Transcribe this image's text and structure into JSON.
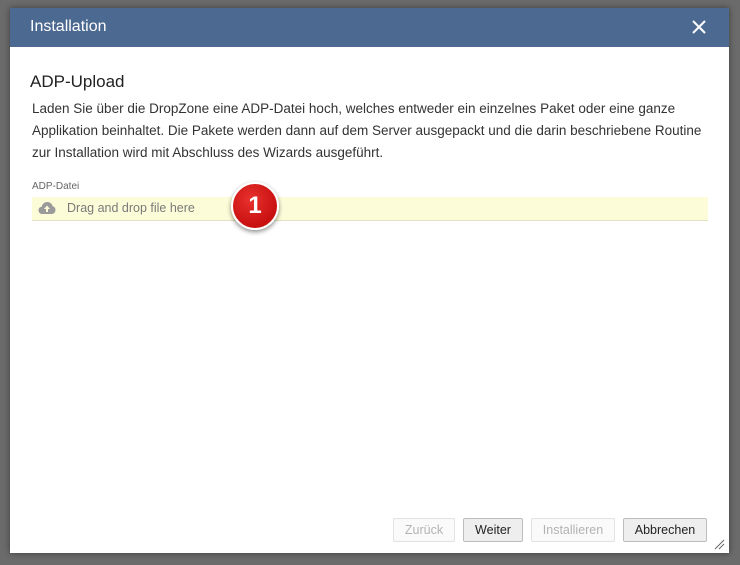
{
  "dialog": {
    "title": "Installation",
    "close_icon": "close-icon"
  },
  "content": {
    "heading": "ADP-Upload",
    "description": "Laden Sie über die DropZone eine ADP-Datei hoch, welches entweder ein einzelnes Paket oder eine ganze Applikation beinhaltet. Die Pakete werden dann auf dem Server ausgepackt und die darin beschriebene Routine zur Installation wird mit Abschluss des Wizards ausgeführt.",
    "field_label": "ADP-Datei",
    "dropzone_text": "Drag and drop file here",
    "dropzone_icon": "cloud-upload-icon",
    "marker_number": "1"
  },
  "buttons": {
    "back": "Zurück",
    "next": "Weiter",
    "install": "Installieren",
    "cancel": "Abbrechen"
  },
  "colors": {
    "titlebar": "#4c6a91",
    "dropzone_bg": "#fdfcd9",
    "marker": "#d71a1a"
  }
}
